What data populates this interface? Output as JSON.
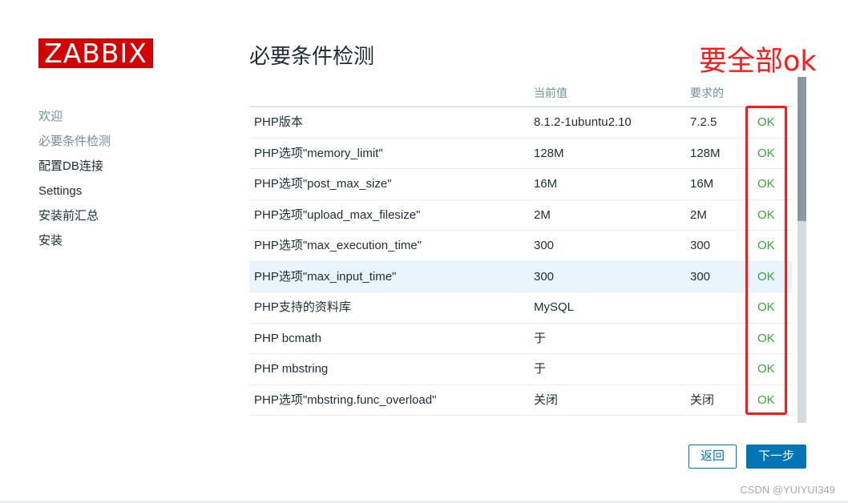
{
  "logo": "ZABBIX",
  "nav": {
    "items": [
      {
        "label": "欢迎"
      },
      {
        "label": "必要条件检测"
      },
      {
        "label": "配置DB连接"
      },
      {
        "label": "Settings"
      },
      {
        "label": "安装前汇总"
      },
      {
        "label": "安装"
      }
    ]
  },
  "page": {
    "title": "必要条件检测"
  },
  "annotation": "要全部ok",
  "table": {
    "headers": [
      "",
      "当前值",
      "要求的",
      ""
    ],
    "rows": [
      {
        "name": "PHP版本",
        "current": "8.1.2-1ubuntu2.10",
        "required": "7.2.5",
        "status": "OK"
      },
      {
        "name": "PHP选项\"memory_limit\"",
        "current": "128M",
        "required": "128M",
        "status": "OK"
      },
      {
        "name": "PHP选项\"post_max_size\"",
        "current": "16M",
        "required": "16M",
        "status": "OK"
      },
      {
        "name": "PHP选项\"upload_max_filesize\"",
        "current": "2M",
        "required": "2M",
        "status": "OK"
      },
      {
        "name": "PHP选项\"max_execution_time\"",
        "current": "300",
        "required": "300",
        "status": "OK"
      },
      {
        "name": "PHP选项\"max_input_time\"",
        "current": "300",
        "required": "300",
        "status": "OK"
      },
      {
        "name": "PHP支持的资料库",
        "current": "MySQL",
        "required": "",
        "status": "OK"
      },
      {
        "name": "PHP bcmath",
        "current": "于",
        "required": "",
        "status": "OK"
      },
      {
        "name": "PHP mbstring",
        "current": "于",
        "required": "",
        "status": "OK"
      },
      {
        "name": "PHP选项\"mbstring.func_overload\"",
        "current": "关闭",
        "required": "关闭",
        "status": "OK"
      }
    ]
  },
  "buttons": {
    "back": "返回",
    "next": "下一步"
  },
  "watermark": "CSDN @YUIYUI349",
  "colors": {
    "brand": "#d40000",
    "ok": "#3aa537",
    "accent": "#0275b8",
    "annotation": "#ff1a1a",
    "highlight_row": "#e8f5ff"
  }
}
